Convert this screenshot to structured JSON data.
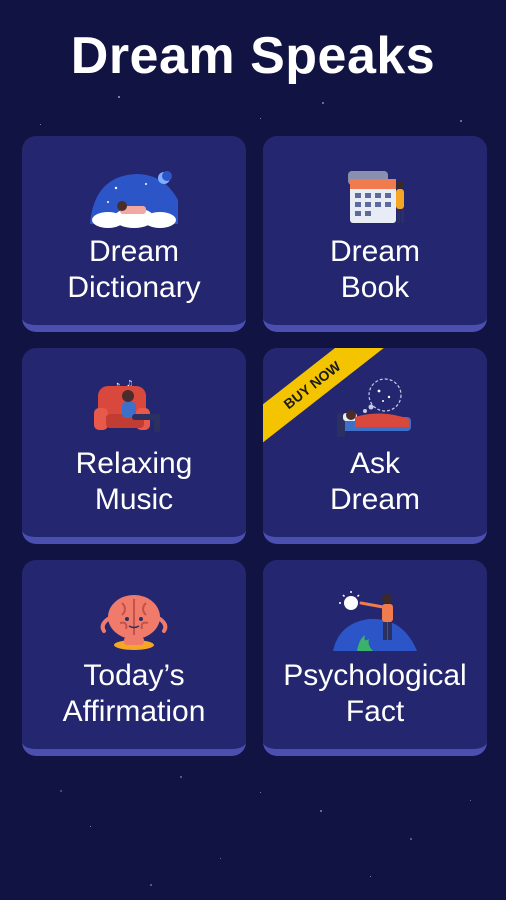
{
  "app": {
    "title": "Dream Speaks"
  },
  "cards": [
    {
      "label_line1": "Dream",
      "label_line2": "Dictionary",
      "icon": "sleeping-cloud-icon"
    },
    {
      "label_line1": "Dream",
      "label_line2": "Book",
      "icon": "calendar-icon"
    },
    {
      "label_line1": "Relaxing",
      "label_line2": "Music",
      "icon": "armchair-music-icon"
    },
    {
      "label_line1": "Ask",
      "label_line2": "Dream",
      "icon": "dream-bed-icon",
      "badge": "BUY NOW"
    },
    {
      "label_line1": "Today’s",
      "label_line2": "Affirmation",
      "icon": "brain-meditation-icon"
    },
    {
      "label_line1": "Psychological",
      "label_line2": "Fact",
      "icon": "person-lightbulb-icon"
    }
  ],
  "colors": {
    "background": "#111342",
    "card": "#24266f",
    "card_edge": "#4a4fb0",
    "badge": "#f5c400"
  }
}
